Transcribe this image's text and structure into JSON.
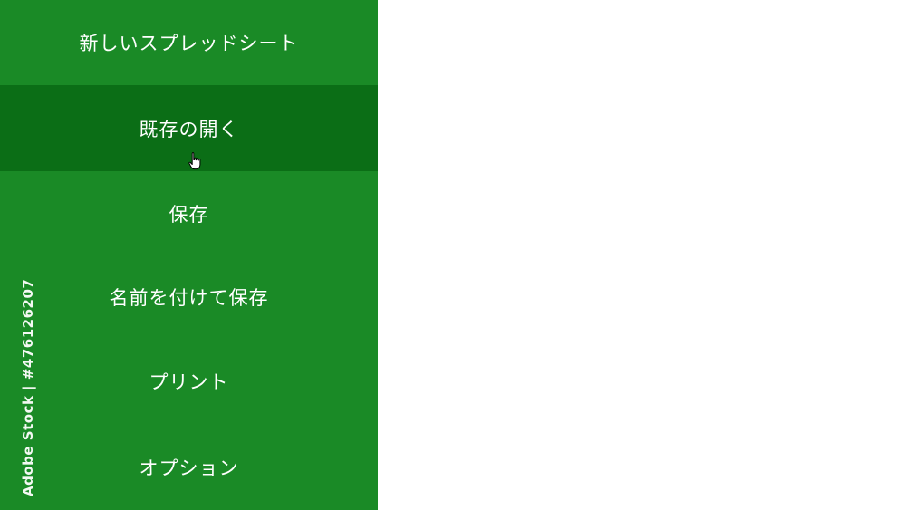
{
  "menu": {
    "items": [
      {
        "label": "新しいスプレッドシート"
      },
      {
        "label": "既存の開く"
      },
      {
        "label": "保存"
      },
      {
        "label": "名前を付けて保存"
      },
      {
        "label": "プリント"
      },
      {
        "label": "オプション"
      }
    ],
    "hovered_item": "既存の開く"
  },
  "watermark": {
    "stock_id": "Adobe Stock | #476126207"
  },
  "colors": {
    "panel": "#1a8a26",
    "hover": "#0b6e16",
    "text": "#ffffff",
    "background": "#ffffff"
  },
  "icons": {
    "cursor": "hand-pointer-icon"
  }
}
